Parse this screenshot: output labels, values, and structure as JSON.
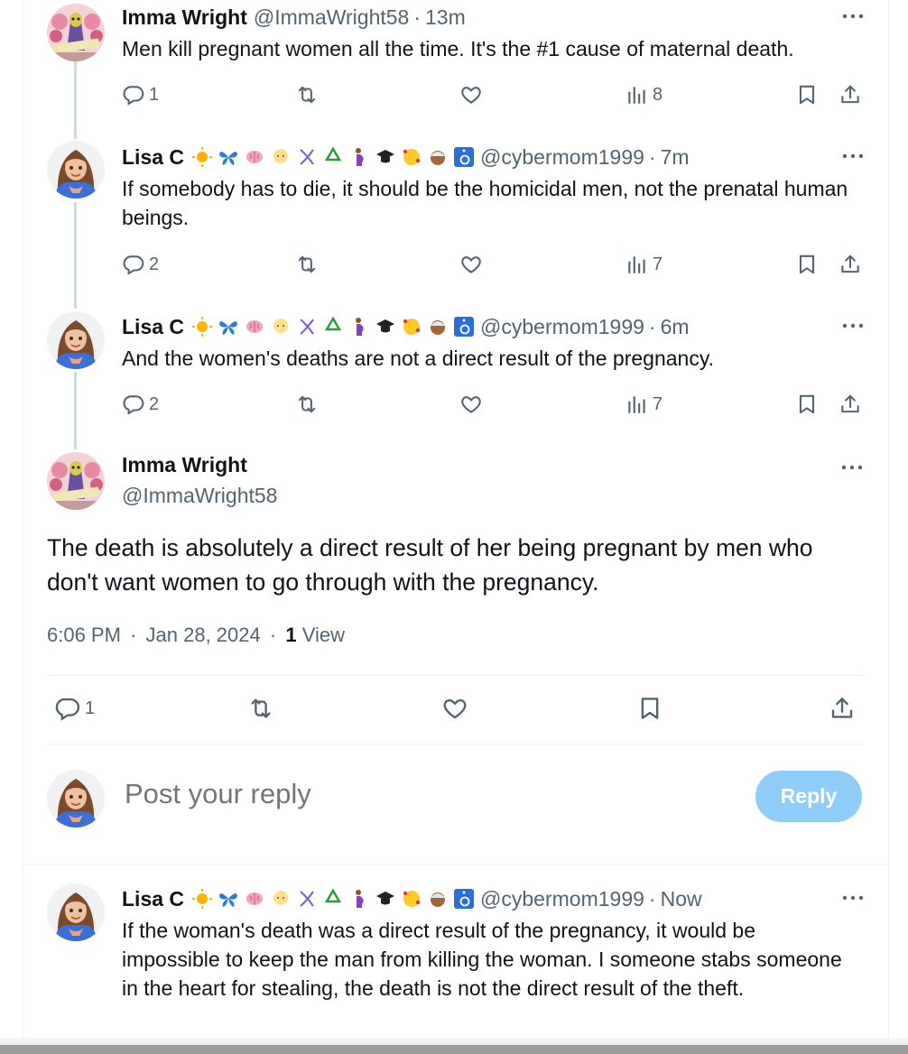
{
  "posts": [
    {
      "name": "Imma Wright",
      "handle": "@ImmaWright58",
      "time": "13m",
      "text": "Men kill pregnant women all the time. It's the #1 cause of maternal death.",
      "replies": "1",
      "reposts": "",
      "likes": "",
      "views": "8"
    },
    {
      "name": "Lisa C",
      "handle": "@cybermom1999",
      "time": "7m",
      "text": "If somebody has to die, it should be the homicidal men, not the prenatal human beings.",
      "replies": "2",
      "reposts": "",
      "likes": "",
      "views": "7"
    },
    {
      "name": "Lisa C",
      "handle": "@cybermom1999",
      "time": "6m",
      "text": "And the women's deaths are not a direct result of the pregnancy.",
      "replies": "2",
      "reposts": "",
      "likes": "",
      "views": "7"
    }
  ],
  "separator": "·",
  "main_post": {
    "name": "Imma Wright",
    "handle": "@ImmaWright58",
    "text": "The death is absolutely a direct result of her being pregnant by men who don't want women to go through with the pregnancy.",
    "time": "6:06 PM",
    "date": "Jan 28, 2024",
    "views_count": "1",
    "views_label": "View",
    "replies": "1"
  },
  "reply_box": {
    "placeholder": "Post your reply",
    "button": "Reply"
  },
  "last_reply": {
    "name": "Lisa C",
    "handle": "@cybermom1999",
    "time": "Now",
    "text": "If the woman's death was a direct result of the pregnancy, it would be impossible to keep the man from killing the woman. I someone stabs someone in the heart for stealing, the death is not the direct result of the theft."
  },
  "icons": [
    "reply-icon",
    "repost-icon",
    "like-icon",
    "views-icon",
    "bookmark-icon",
    "share-icon",
    "more-icon"
  ],
  "colors": {
    "accent": "#1d9bf0",
    "reply_button_disabled": "#8ecdf8",
    "secondary_text": "#536471",
    "thread_line": "#cfd9de"
  }
}
